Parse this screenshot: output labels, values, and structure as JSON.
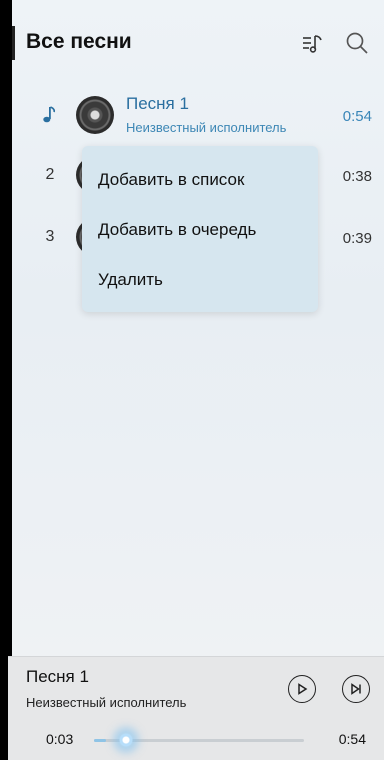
{
  "header": {
    "title": "Все песни",
    "icons": [
      "playlist-music-icon",
      "search-icon"
    ]
  },
  "songs": [
    {
      "index": "",
      "title": "Песня 1",
      "artist": "Неизвестный исполнитель",
      "duration": "0:54",
      "playing": true
    },
    {
      "index": "2",
      "title": "",
      "artist": "",
      "duration": "0:38",
      "playing": false
    },
    {
      "index": "3",
      "title": "",
      "artist": "",
      "duration": "0:39",
      "playing": false
    }
  ],
  "context_menu": {
    "items": [
      "Добавить в список",
      "Добавить в очередь",
      "Удалить"
    ]
  },
  "player": {
    "title": "Песня 1",
    "artist": "Неизвестный исполнитель",
    "current_time": "0:03",
    "total_time": "0:54",
    "progress": 0.055,
    "icons": [
      "play-icon",
      "next-icon"
    ]
  },
  "colors": {
    "accent": "#3a86b8",
    "menu_bg": "#d6e6ef",
    "player_bg": "#e6e7e8"
  }
}
